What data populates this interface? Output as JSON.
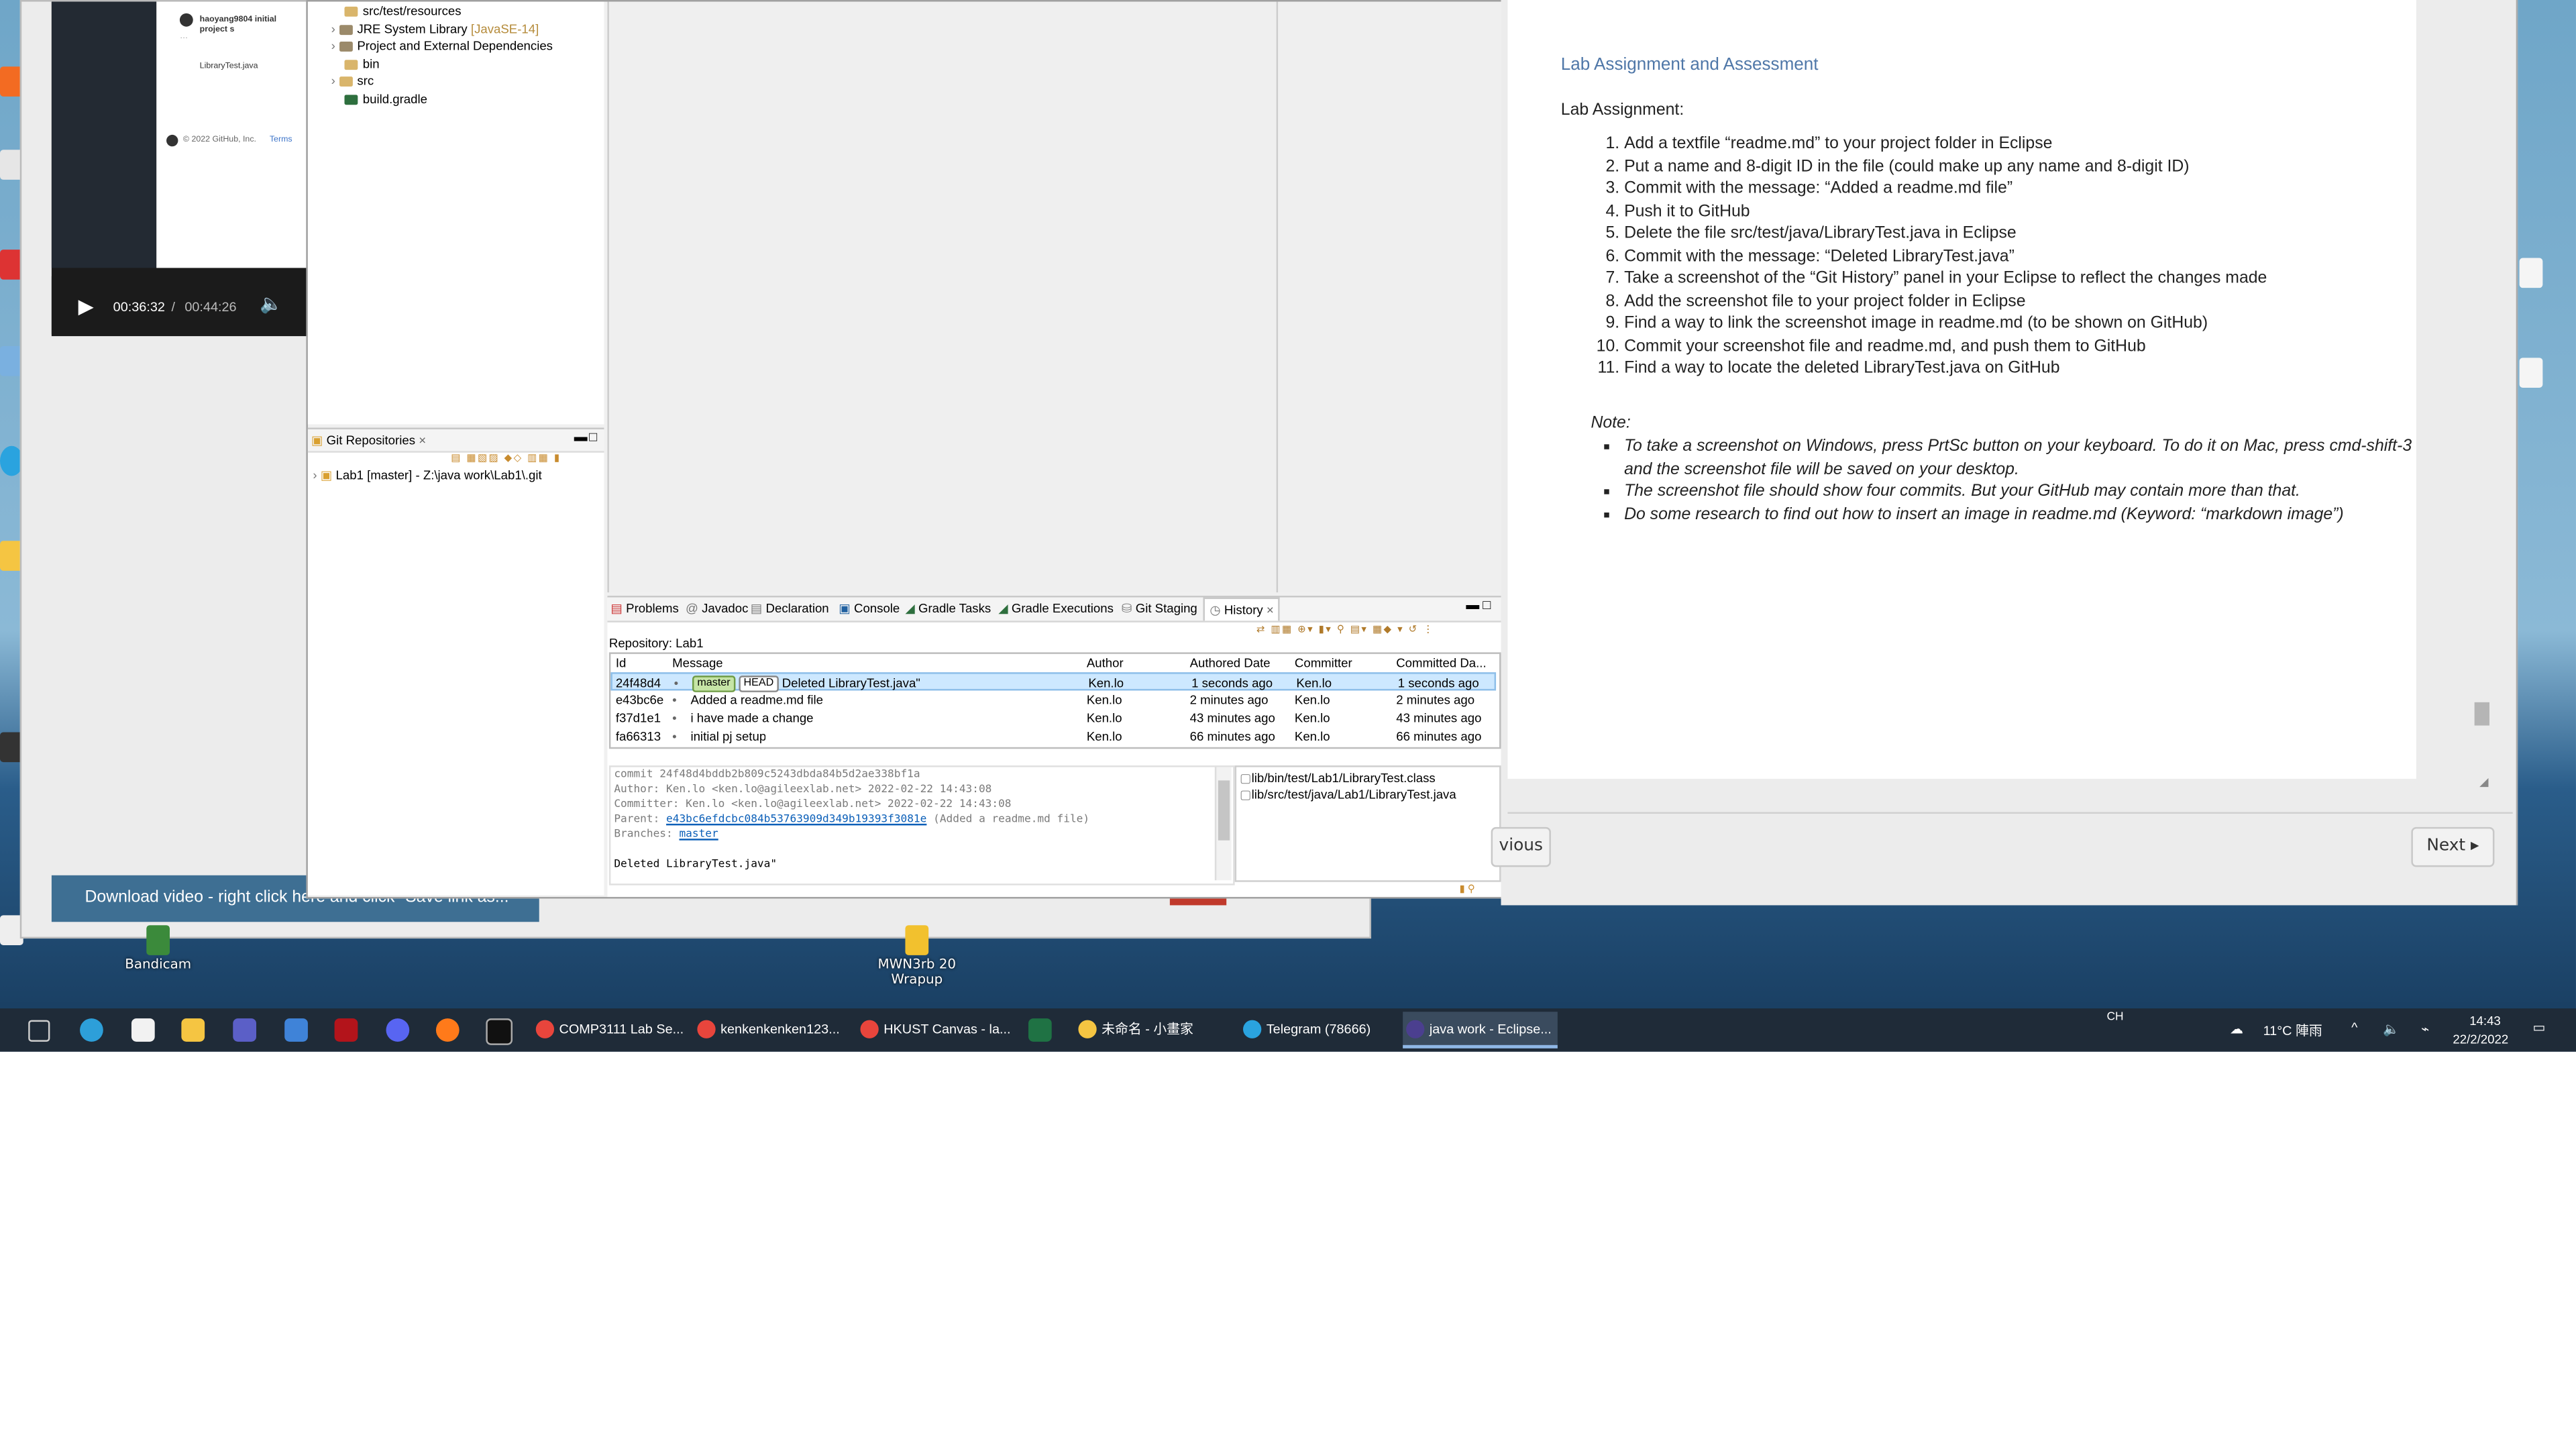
{
  "video": {
    "github_user_commit": "haoyang9804 initial project s",
    "file_link": "LibraryTest.java",
    "github_footer": "© 2022 GitHub, Inc.",
    "github_footer_terms": "Terms",
    "time_current": "00:36:32",
    "time_separator": "/",
    "time_total": "00:44:26",
    "download_banner": "Download video - right click here and click \"Save link as...\""
  },
  "eclipse": {
    "package_tree": [
      {
        "label": "src/test/resources",
        "suffix": ""
      },
      {
        "label": "JRE System Library",
        "suffix": "[JavaSE-14]"
      },
      {
        "label": "Project and External Dependencies",
        "suffix": ""
      },
      {
        "label": "bin",
        "suffix": ""
      },
      {
        "label": "src",
        "suffix": ""
      },
      {
        "label": "build.gradle",
        "suffix": ""
      }
    ],
    "git_repos_title": "Git Repositories",
    "git_repo_item": "Lab1 [master] - Z:\\java work\\Lab1\\.git",
    "tabs": [
      "Problems",
      "Javadoc",
      "Declaration",
      "Console",
      "Gradle Tasks",
      "Gradle Executions",
      "Git Staging",
      "History"
    ],
    "repository_label": "Repository: Lab1",
    "history_columns": [
      "Id",
      "Message",
      "Author",
      "Authored Date",
      "Committer",
      "Committed Da..."
    ],
    "history_rows": [
      {
        "id": "24f48d4",
        "refs": [
          "master",
          "HEAD"
        ],
        "message": "Deleted LibraryTest.java\"",
        "author": "Ken.lo",
        "authored": "1 seconds ago",
        "committer": "Ken.lo",
        "committed": "1 seconds ago"
      },
      {
        "id": "e43bc6e",
        "refs": [],
        "message": "Added a readme.md file",
        "author": "Ken.lo",
        "authored": "2 minutes ago",
        "committer": "Ken.lo",
        "committed": "2 minutes ago"
      },
      {
        "id": "f37d1e1",
        "refs": [],
        "message": "i have made a change",
        "author": "Ken.lo",
        "authored": "43 minutes ago",
        "committer": "Ken.lo",
        "committed": "43 minutes ago"
      },
      {
        "id": "fa66313",
        "refs": [],
        "message": "initial pj setup",
        "author": "Ken.lo",
        "authored": "66 minutes ago",
        "committer": "Ken.lo",
        "committed": "66 minutes ago"
      }
    ],
    "commit_detail": {
      "commit": "commit 24f48d4bddb2b809c5243dbda84b5d2ae338bf1a",
      "author": "Author: Ken.lo <ken.lo@agileexlab.net> 2022-02-22 14:43:08",
      "committer": "Committer: Ken.lo <ken.lo@agileexlab.net> 2022-02-22 14:43:08",
      "parent_prefix": "Parent:",
      "parent_hash": "e43bc6efdcbc084b53763909d349b19393f3081e",
      "parent_suffix": "(Added a readme.md file)",
      "branches_prefix": "Branches:",
      "branches_value": "master",
      "message": "Deleted LibraryTest.java\""
    },
    "changed_files": [
      "lib/bin/test/Lab1/LibraryTest.class",
      "lib/src/test/java/Lab1/LibraryTest.java"
    ]
  },
  "lab": {
    "heading": "Lab Assignment and Assessment",
    "subheading": "Lab Assignment:",
    "steps": [
      "Add a textfile “readme.md” to your project folder in Eclipse",
      "Put a name and 8-digit ID in the file (could make up any name and 8-digit ID)",
      "Commit with the message: “Added a readme.md file”",
      "Push it to GitHub",
      "Delete the file src/test/java/LibraryTest.java in Eclipse",
      "Commit with the message: “Deleted LibraryTest.java”",
      "Take a screenshot of the “Git History” panel in your Eclipse to reflect the changes made",
      "Add the screenshot file to your project folder in Eclipse",
      "Find a way to link the screenshot image in readme.md (to be shown on GitHub)",
      "Commit your screenshot file and readme.md, and push them to GitHub",
      "Find a way to locate the deleted LibraryTest.java on GitHub"
    ],
    "note_title": "Note:",
    "notes": [
      "To take a screenshot on Windows, press PrtSc button on your keyboard.  To do it on Mac, press cmd-shift-3 and the screenshot file will be saved on your desktop.",
      "The screenshot file should show four commits.  But your GitHub may contain more than that.",
      "Do some research to find out how to insert an image in readme.md (Keyword: “markdown image”)"
    ],
    "prev_button": "vious",
    "next_button": "Next ▸"
  },
  "desktop_labels": [
    {
      "text": "Bandicam"
    },
    {
      "text": "MWN3rb 20 Wrapup"
    }
  ],
  "taskbar": {
    "apps": [
      {
        "label": "COMP3111 Lab Se...",
        "color": "#e8453c"
      },
      {
        "label": "kenkenkenken123...",
        "color": "#e8453c"
      },
      {
        "label": "HKUST Canvas - la...",
        "color": "#e8453c"
      },
      {
        "label": "未命名 - 小畫家",
        "color": "#f5c542"
      },
      {
        "label": "Telegram (78666)",
        "color": "#2aa3df"
      },
      {
        "label": "java work - Eclipse...",
        "color": "#4b3f8f"
      }
    ],
    "ime": "CH",
    "weather": "11°C 陣雨",
    "time": "14:43",
    "date": "22/2/2022"
  }
}
